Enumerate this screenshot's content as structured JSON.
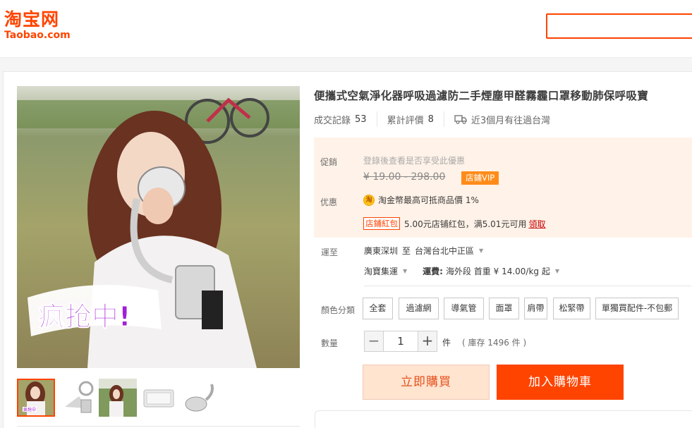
{
  "header": {
    "logo_cn": "淘宝网",
    "logo_en": "Taobao.com"
  },
  "colors": {
    "brand": "#ff4400",
    "promo_bg": "#fff2e8",
    "vip_badge": "#ff8c1a",
    "buy_bg": "#ffe4d0",
    "buy_text": "#e5511d"
  },
  "product": {
    "title": "便攜式空氣淨化器呼吸過濾防二手煙塵甲醛霧霾口罩移動肺保呼吸寶",
    "image_badge": "疯抢中!",
    "thumbnail_count": 5,
    "stats": [
      {
        "label": "成交記錄",
        "value": "53"
      },
      {
        "label": "累計評價",
        "value": "8"
      }
    ],
    "delivery_note": "近3個月有往過台灣"
  },
  "promo": {
    "price_label": "促銷",
    "login_hint": "登錄後查看是否享受此優惠",
    "price_range": "¥ 19.00 - 298.00",
    "vip_badge": "店鋪VIP",
    "discount_label": "优惠",
    "coin_icon": "淘",
    "coin_text": "淘金幣最高可抵商品價 1%",
    "packet_tag": "店鋪紅包",
    "packet_text": "5.00元店铺红包，满5.01元可用",
    "claim_link": "領取"
  },
  "shipping": {
    "label": "運至",
    "origin": "廣東深圳",
    "to_word": "至",
    "destination": "台灣台北中正區",
    "method": "淘寶集運",
    "fee_label": "運費:",
    "fee_value": "海外段 首重 ¥ 14.00/kg 起"
  },
  "sku": {
    "label": "顏色分類",
    "options": [
      "全套",
      "過濾網",
      "導氣管",
      "面罩",
      "肩帶",
      "松緊帶",
      "單獨買配件-不包郵"
    ]
  },
  "quantity": {
    "label": "數量",
    "minus": "−",
    "plus": "+",
    "value": "1",
    "unit": "件",
    "stock": "( 庫存 1496 件 )"
  },
  "actions": {
    "buy_now": "立即購買",
    "add_to_cart": "加入購物車"
  }
}
